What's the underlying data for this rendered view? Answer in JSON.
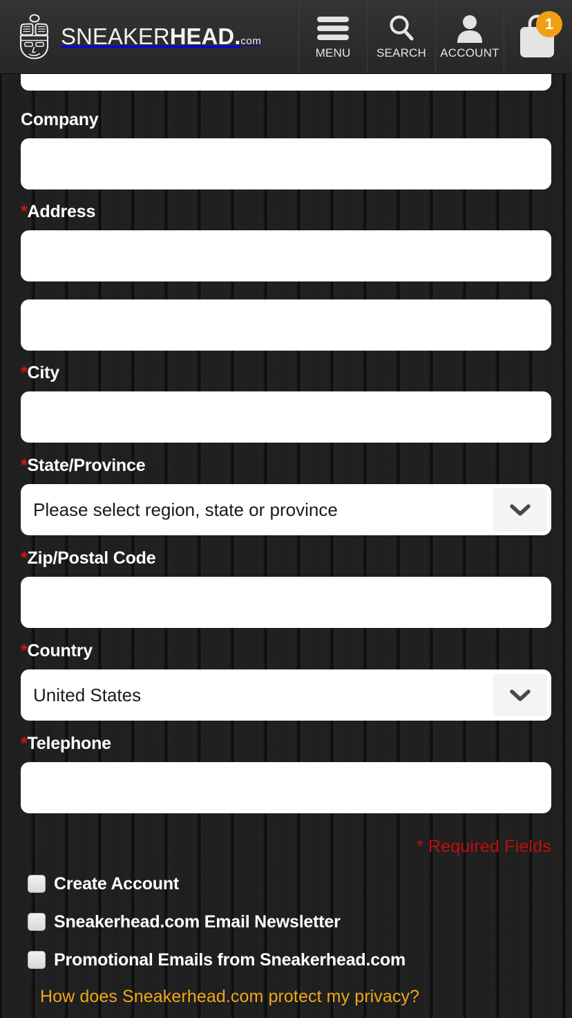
{
  "header": {
    "logo": {
      "icon": "sneakerhead-face-logo-icon",
      "word_light": "SNEAKER",
      "word_bold": "HEAD",
      "dot": ".",
      "tld": "com"
    },
    "buttons": [
      {
        "id": "menu",
        "label": "MENU",
        "icon": "hamburger-menu-icon"
      },
      {
        "id": "search",
        "label": "SEARCH",
        "icon": "search-icon"
      },
      {
        "id": "account",
        "label": "ACCOUNT",
        "icon": "account-person-icon"
      }
    ],
    "cart": {
      "icon": "shopping-bag-icon",
      "count": "1",
      "badge_color": "#f0a010"
    },
    "background_color": "#2e2e2e"
  },
  "form": {
    "fields": [
      {
        "id": "lastname_partial",
        "type": "text-clipped",
        "label": "",
        "required": false,
        "value": "",
        "placeholder": ""
      },
      {
        "id": "company",
        "type": "text",
        "label": "Company",
        "required": false,
        "value": "",
        "placeholder": ""
      },
      {
        "id": "address1",
        "type": "text",
        "label": "Address",
        "required": true,
        "value": "",
        "placeholder": ""
      },
      {
        "id": "address2",
        "type": "text",
        "label": "",
        "required": false,
        "value": "",
        "placeholder": ""
      },
      {
        "id": "city",
        "type": "text",
        "label": "City",
        "required": true,
        "value": "",
        "placeholder": ""
      },
      {
        "id": "region",
        "type": "select",
        "label": "State/Province",
        "required": true,
        "value": "Please select region, state or province"
      },
      {
        "id": "zip",
        "type": "text",
        "label": "Zip/Postal Code",
        "required": true,
        "value": "",
        "placeholder": ""
      },
      {
        "id": "country",
        "type": "select",
        "label": "Country",
        "required": true,
        "value": "United States"
      },
      {
        "id": "telephone",
        "type": "text",
        "label": "Telephone",
        "required": true,
        "value": "",
        "placeholder": ""
      }
    ],
    "required_marker": "*",
    "required_note": "* Required Fields",
    "required_note_color": "#c10d0d",
    "dropdown_icon": "chevron-down-icon"
  },
  "options": {
    "checkboxes": [
      {
        "id": "create-account",
        "label": "Create Account",
        "checked": false
      },
      {
        "id": "email-newsletter",
        "label": "Sneakerhead.com Email Newsletter",
        "checked": false
      },
      {
        "id": "promotional-email",
        "label": "Promotional Emails from Sneakerhead.com",
        "checked": false
      }
    ],
    "privacy_link": "How does Sneakerhead.com protect my privacy?",
    "privacy_link_color": "#f0a81a"
  }
}
